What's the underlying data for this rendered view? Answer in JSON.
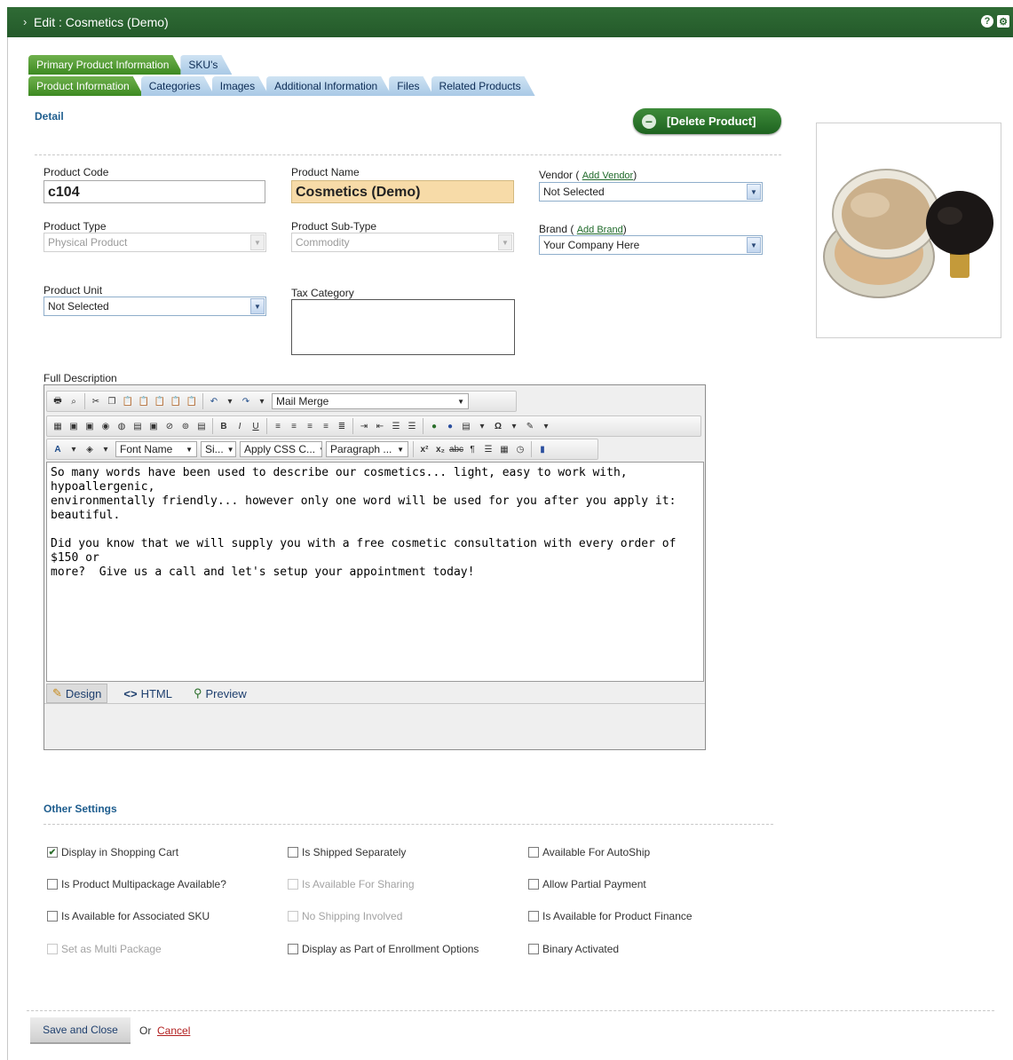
{
  "window": {
    "title": "Edit : Cosmetics (Demo)"
  },
  "tabs_primary": [
    {
      "label": "Primary Product Information",
      "active": true
    },
    {
      "label": "SKU's",
      "active": false
    }
  ],
  "tabs_secondary": [
    {
      "label": "Product Information",
      "active": true
    },
    {
      "label": "Categories",
      "active": false
    },
    {
      "label": "Images",
      "active": false
    },
    {
      "label": "Additional Information",
      "active": false
    },
    {
      "label": "Files",
      "active": false
    },
    {
      "label": "Related Products",
      "active": false
    }
  ],
  "detail": {
    "section_title": "Detail",
    "delete_button": "[Delete Product]",
    "product_code": {
      "label": "Product Code",
      "value": "c104"
    },
    "product_name": {
      "label": "Product Name",
      "value": "Cosmetics (Demo)"
    },
    "vendor": {
      "label": "Vendor (",
      "link": "Add Vendor",
      "close": ")",
      "value": "Not Selected"
    },
    "product_type": {
      "label": "Product Type",
      "value": "Physical Product"
    },
    "product_subtype": {
      "label": "Product Sub-Type",
      "value": "Commodity"
    },
    "brand": {
      "label": "Brand (",
      "link": "Add Brand",
      "close": ")",
      "value": "Your Company Here"
    },
    "product_unit": {
      "label": "Product Unit",
      "value": "Not Selected"
    },
    "tax_category": {
      "label": "Tax Category",
      "value": ""
    }
  },
  "editor": {
    "label": "Full Description",
    "toolbar": {
      "mail_merge": "Mail Merge",
      "font_name": "Font Name",
      "font_size": "Si...",
      "css_class": "Apply CSS C...",
      "paragraph": "Paragraph ..."
    },
    "content": "So many words have been used to describe our cosmetics... light, easy to work with, hypoallergenic,\nenvironmentally friendly... however only one word will be used for you after you apply it: beautiful.\n\nDid you know that we will supply you with a free cosmetic consultation with every order of $150 or\nmore?  Give us a call and let's setup your appointment today!",
    "modes": {
      "design": "Design",
      "html": "HTML",
      "preview": "Preview"
    }
  },
  "other_settings": {
    "section_title": "Other Settings",
    "checkboxes": [
      {
        "label": "Display in Shopping Cart",
        "checked": true,
        "disabled": false
      },
      {
        "label": "Is Shipped Separately",
        "checked": false,
        "disabled": false
      },
      {
        "label": "Available For AutoShip",
        "checked": false,
        "disabled": false
      },
      {
        "label": "Is Product Multipackage Available?",
        "checked": false,
        "disabled": false
      },
      {
        "label": "Is Available For Sharing",
        "checked": false,
        "disabled": true
      },
      {
        "label": "Allow Partial Payment",
        "checked": false,
        "disabled": false
      },
      {
        "label": "Is Available for Associated SKU",
        "checked": false,
        "disabled": false
      },
      {
        "label": "No Shipping Involved",
        "checked": false,
        "disabled": true
      },
      {
        "label": "Is Available for Product Finance",
        "checked": false,
        "disabled": false
      },
      {
        "label": "Set as Multi Package",
        "checked": false,
        "disabled": true
      },
      {
        "label": "Display as Part of Enrollment Options",
        "checked": false,
        "disabled": false
      },
      {
        "label": "Binary Activated",
        "checked": false,
        "disabled": false
      }
    ]
  },
  "footer": {
    "save_label": "Save and Close",
    "or_text": "Or",
    "cancel_label": "Cancel"
  },
  "colors": {
    "header_green": "#2f6b35",
    "active_tab_green": "#3d8a22",
    "inactive_tab_blue": "#a9c9e6",
    "section_title_blue": "#1e5d8e",
    "highlight_field": "#f7dba8",
    "cancel_red": "#b22020"
  }
}
